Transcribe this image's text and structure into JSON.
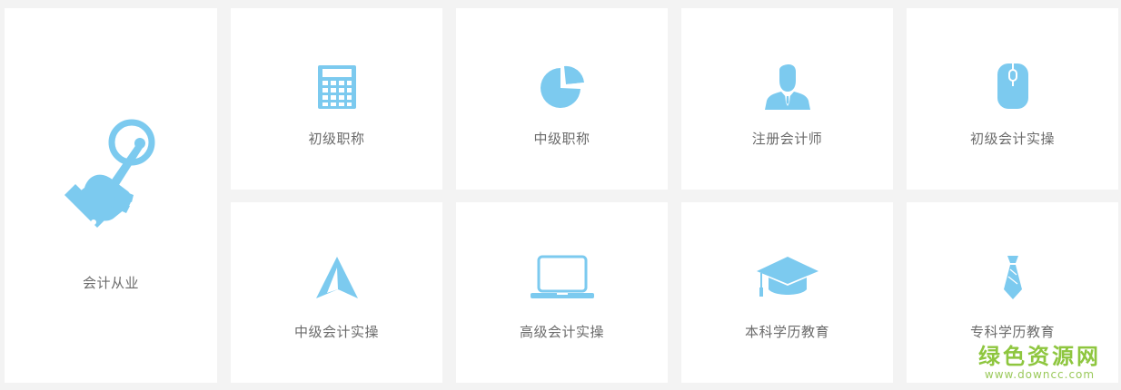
{
  "tiles": [
    {
      "label": "会计从业",
      "icon": "hand-pointing-icon"
    },
    {
      "label": "初级职称",
      "icon": "calculator-icon"
    },
    {
      "label": "中级职称",
      "icon": "pie-chart-icon"
    },
    {
      "label": "注册会计师",
      "icon": "businessman-icon"
    },
    {
      "label": "初级会计实操",
      "icon": "mouse-icon"
    },
    {
      "label": "中级会计实操",
      "icon": "navigation-arrow-icon"
    },
    {
      "label": "高级会计实操",
      "icon": "laptop-icon"
    },
    {
      "label": "本科学历教育",
      "icon": "graduation-cap-icon"
    },
    {
      "label": "专科学历教育",
      "icon": "necktie-icon"
    }
  ],
  "watermark": {
    "title": "绿色资源网",
    "url": "www.downcc.com"
  },
  "colors": {
    "icon": "#7ccaef",
    "label": "#6b6b6b",
    "tile_bg": "#ffffff",
    "page_bg": "#f3f3f3",
    "watermark": "#8ec63f"
  }
}
